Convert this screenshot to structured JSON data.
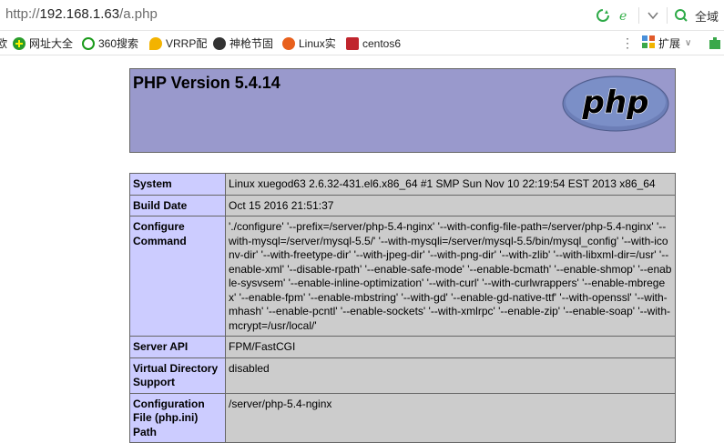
{
  "browser": {
    "url_scheme": "http://",
    "url_host": "192.168.1.63",
    "url_path": "/a.php",
    "search_label": "全域"
  },
  "bookmarks": {
    "left_fragment": "欧",
    "items": [
      {
        "label": "网址大全",
        "color": "#2a9d2a"
      },
      {
        "label": "360搜索",
        "color": "#1a9a1a"
      },
      {
        "label": "VRRP配",
        "color": "#f3b300"
      },
      {
        "label": "神枪节固",
        "color": "#333333"
      },
      {
        "label": "Linux实",
        "color": "#e8601c"
      },
      {
        "label": "centos6",
        "color": "#c0252d"
      }
    ],
    "extensions_label": "扩展"
  },
  "phpinfo": {
    "title": "PHP Version 5.4.14",
    "logo_text": "php",
    "rows": [
      {
        "key": "System",
        "value": "Linux xuegod63 2.6.32-431.el6.x86_64 #1 SMP Sun Nov 10 22:19:54 EST 2013 x86_64"
      },
      {
        "key": "Build Date",
        "value": "Oct 15 2016 21:51:37"
      },
      {
        "key": "Configure Command",
        "value": "'./configure' '--prefix=/server/php-5.4-nginx' '--with-config-file-path=/server/php-5.4-nginx' '--with-mysql=/server/mysql-5.5/' '--with-mysqli=/server/mysql-5.5/bin/mysql_config' '--with-iconv-dir' '--with-freetype-dir' '--with-jpeg-dir' '--with-png-dir' '--with-zlib' '--with-libxml-dir=/usr' '--enable-xml' '--disable-rpath' '--enable-safe-mode' '--enable-bcmath' '--enable-shmop' '--enable-sysvsem' '--enable-inline-optimization' '--with-curl' '--with-curlwrappers' '--enable-mbregex' '--enable-fpm' '--enable-mbstring' '--with-gd' '--enable-gd-native-ttf' '--with-openssl' '--with-mhash' '--enable-pcntl' '--enable-sockets' '--with-xmlrpc' '--enable-zip' '--enable-soap' '--with-mcrypt=/usr/local/'"
      },
      {
        "key": "Server API",
        "value": "FPM/FastCGI"
      },
      {
        "key": "Virtual Directory Support",
        "value": "disabled"
      },
      {
        "key": "Configuration File (php.ini) Path",
        "value": "/server/php-5.4-nginx"
      }
    ]
  }
}
